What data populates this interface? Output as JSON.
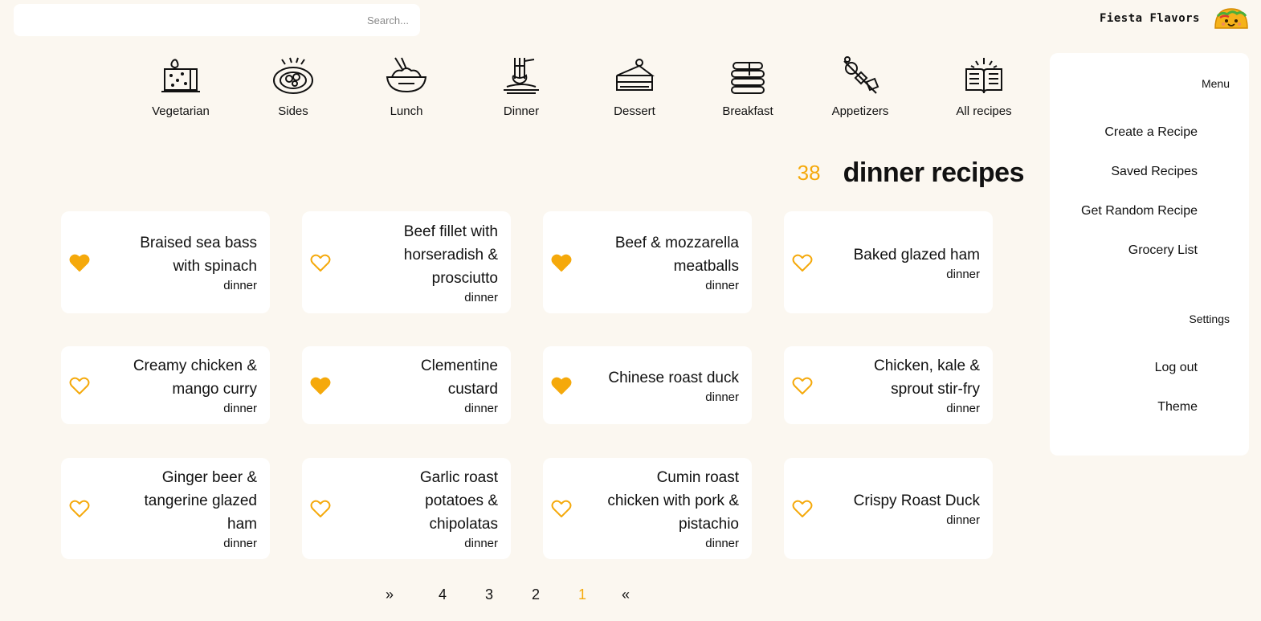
{
  "brand": {
    "name": "Fiesta Flavors",
    "logo_icon": "taco-icon"
  },
  "search": {
    "placeholder": "Search..."
  },
  "sidebar": {
    "menu_heading": "Menu",
    "menu_items": [
      {
        "label": "Create a Recipe"
      },
      {
        "label": "Saved Recipes"
      },
      {
        "label": "Get Random Recipe"
      },
      {
        "label": "Grocery List"
      }
    ],
    "settings_heading": "Settings",
    "settings_items": [
      {
        "label": "Log out"
      },
      {
        "label": "Theme"
      }
    ]
  },
  "categories": [
    {
      "label": "All recipes",
      "icon": "open-book-icon"
    },
    {
      "label": "Appetizers",
      "icon": "skewer-icon"
    },
    {
      "label": "Breakfast",
      "icon": "pancakes-icon"
    },
    {
      "label": "Dessert",
      "icon": "cake-slice-icon"
    },
    {
      "label": "Dinner",
      "icon": "spaghetti-fork-icon"
    },
    {
      "label": "Lunch",
      "icon": "rice-bowl-icon"
    },
    {
      "label": "Sides",
      "icon": "side-dish-icon"
    },
    {
      "label": "Vegetarian",
      "icon": "tofu-icon"
    }
  ],
  "heading": {
    "title": "dinner recipes",
    "count": "38"
  },
  "recipes": [
    {
      "name": [
        "Baked glazed ham"
      ],
      "category": "dinner",
      "favorite": false
    },
    {
      "name": [
        "Beef & mozzarella",
        "meatballs"
      ],
      "category": "dinner",
      "favorite": true
    },
    {
      "name": [
        "Beef fillet with",
        "horseradish &",
        "prosciutto"
      ],
      "category": "dinner",
      "favorite": false
    },
    {
      "name": [
        "Braised sea bass",
        "with spinach"
      ],
      "category": "dinner",
      "favorite": true
    },
    {
      "name": [
        "Chicken, kale &",
        "sprout stir-fry"
      ],
      "category": "dinner",
      "favorite": false
    },
    {
      "name": [
        "Chinese roast duck"
      ],
      "category": "dinner",
      "favorite": true
    },
    {
      "name": [
        "Clementine",
        "custard"
      ],
      "category": "dinner",
      "favorite": true
    },
    {
      "name": [
        "Creamy chicken &",
        "mango curry"
      ],
      "category": "dinner",
      "favorite": false
    },
    {
      "name": [
        "Crispy Roast Duck"
      ],
      "category": "dinner",
      "favorite": false
    },
    {
      "name": [
        "Cumin roast",
        "chicken with pork &",
        "pistachio"
      ],
      "category": "dinner",
      "favorite": false
    },
    {
      "name": [
        "Garlic roast",
        "potatoes &",
        "chipolatas"
      ],
      "category": "dinner",
      "favorite": false
    },
    {
      "name": [
        "Ginger beer &",
        "tangerine glazed",
        "ham"
      ],
      "category": "dinner",
      "favorite": false
    }
  ],
  "pagination": {
    "first": "«",
    "pages": [
      "1",
      "2",
      "3",
      "4"
    ],
    "last": "»",
    "current": "1"
  },
  "colors": {
    "accent": "#f5a90b",
    "background": "#fbf7f0",
    "card": "#ffffff"
  }
}
